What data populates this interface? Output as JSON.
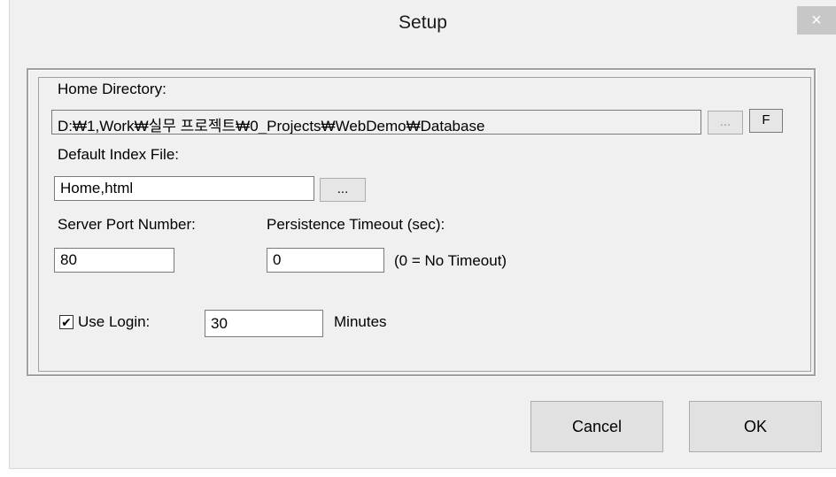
{
  "window": {
    "title": "Setup",
    "close_glyph": "×"
  },
  "home_directory": {
    "label": "Home Directory:",
    "value": "D:₩1,Work₩실무 프로젝트₩0_Projects₩WebDemo₩Database",
    "browse_label": "...",
    "f_label": "F"
  },
  "default_index": {
    "label": "Default Index File:",
    "value": "Home,html",
    "browse_label": "..."
  },
  "server_port": {
    "label": "Server Port Number:",
    "value": "80"
  },
  "persistence": {
    "label": "Persistence Timeout (sec):",
    "value": "0",
    "hint": "(0 = No Timeout)"
  },
  "login": {
    "checked": true,
    "check_glyph": "✔",
    "label": "Use Login:",
    "value": "30",
    "unit": "Minutes"
  },
  "buttons": {
    "cancel": "Cancel",
    "ok": "OK"
  }
}
